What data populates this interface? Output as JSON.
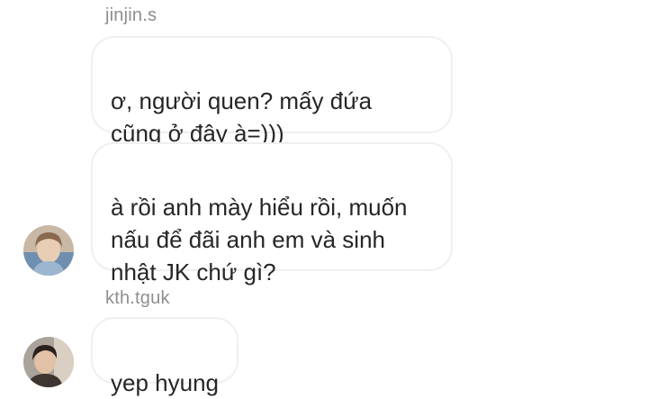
{
  "thread": {
    "sender_1": "jinjin.s",
    "messages_1": [
      "ơ, người quen? mấy đứa\ncũng ở đây à=)))",
      "à rồi anh mày hiểu rồi, muốn\nnấu để đãi anh em và sinh\nnhật JK chứ gì?"
    ],
    "sender_2": "kth.tguk",
    "messages_2": [
      "yep hyung"
    ]
  },
  "avatars": {
    "sender_1": "user-avatar-photo",
    "sender_2": "user-avatar-photo"
  }
}
